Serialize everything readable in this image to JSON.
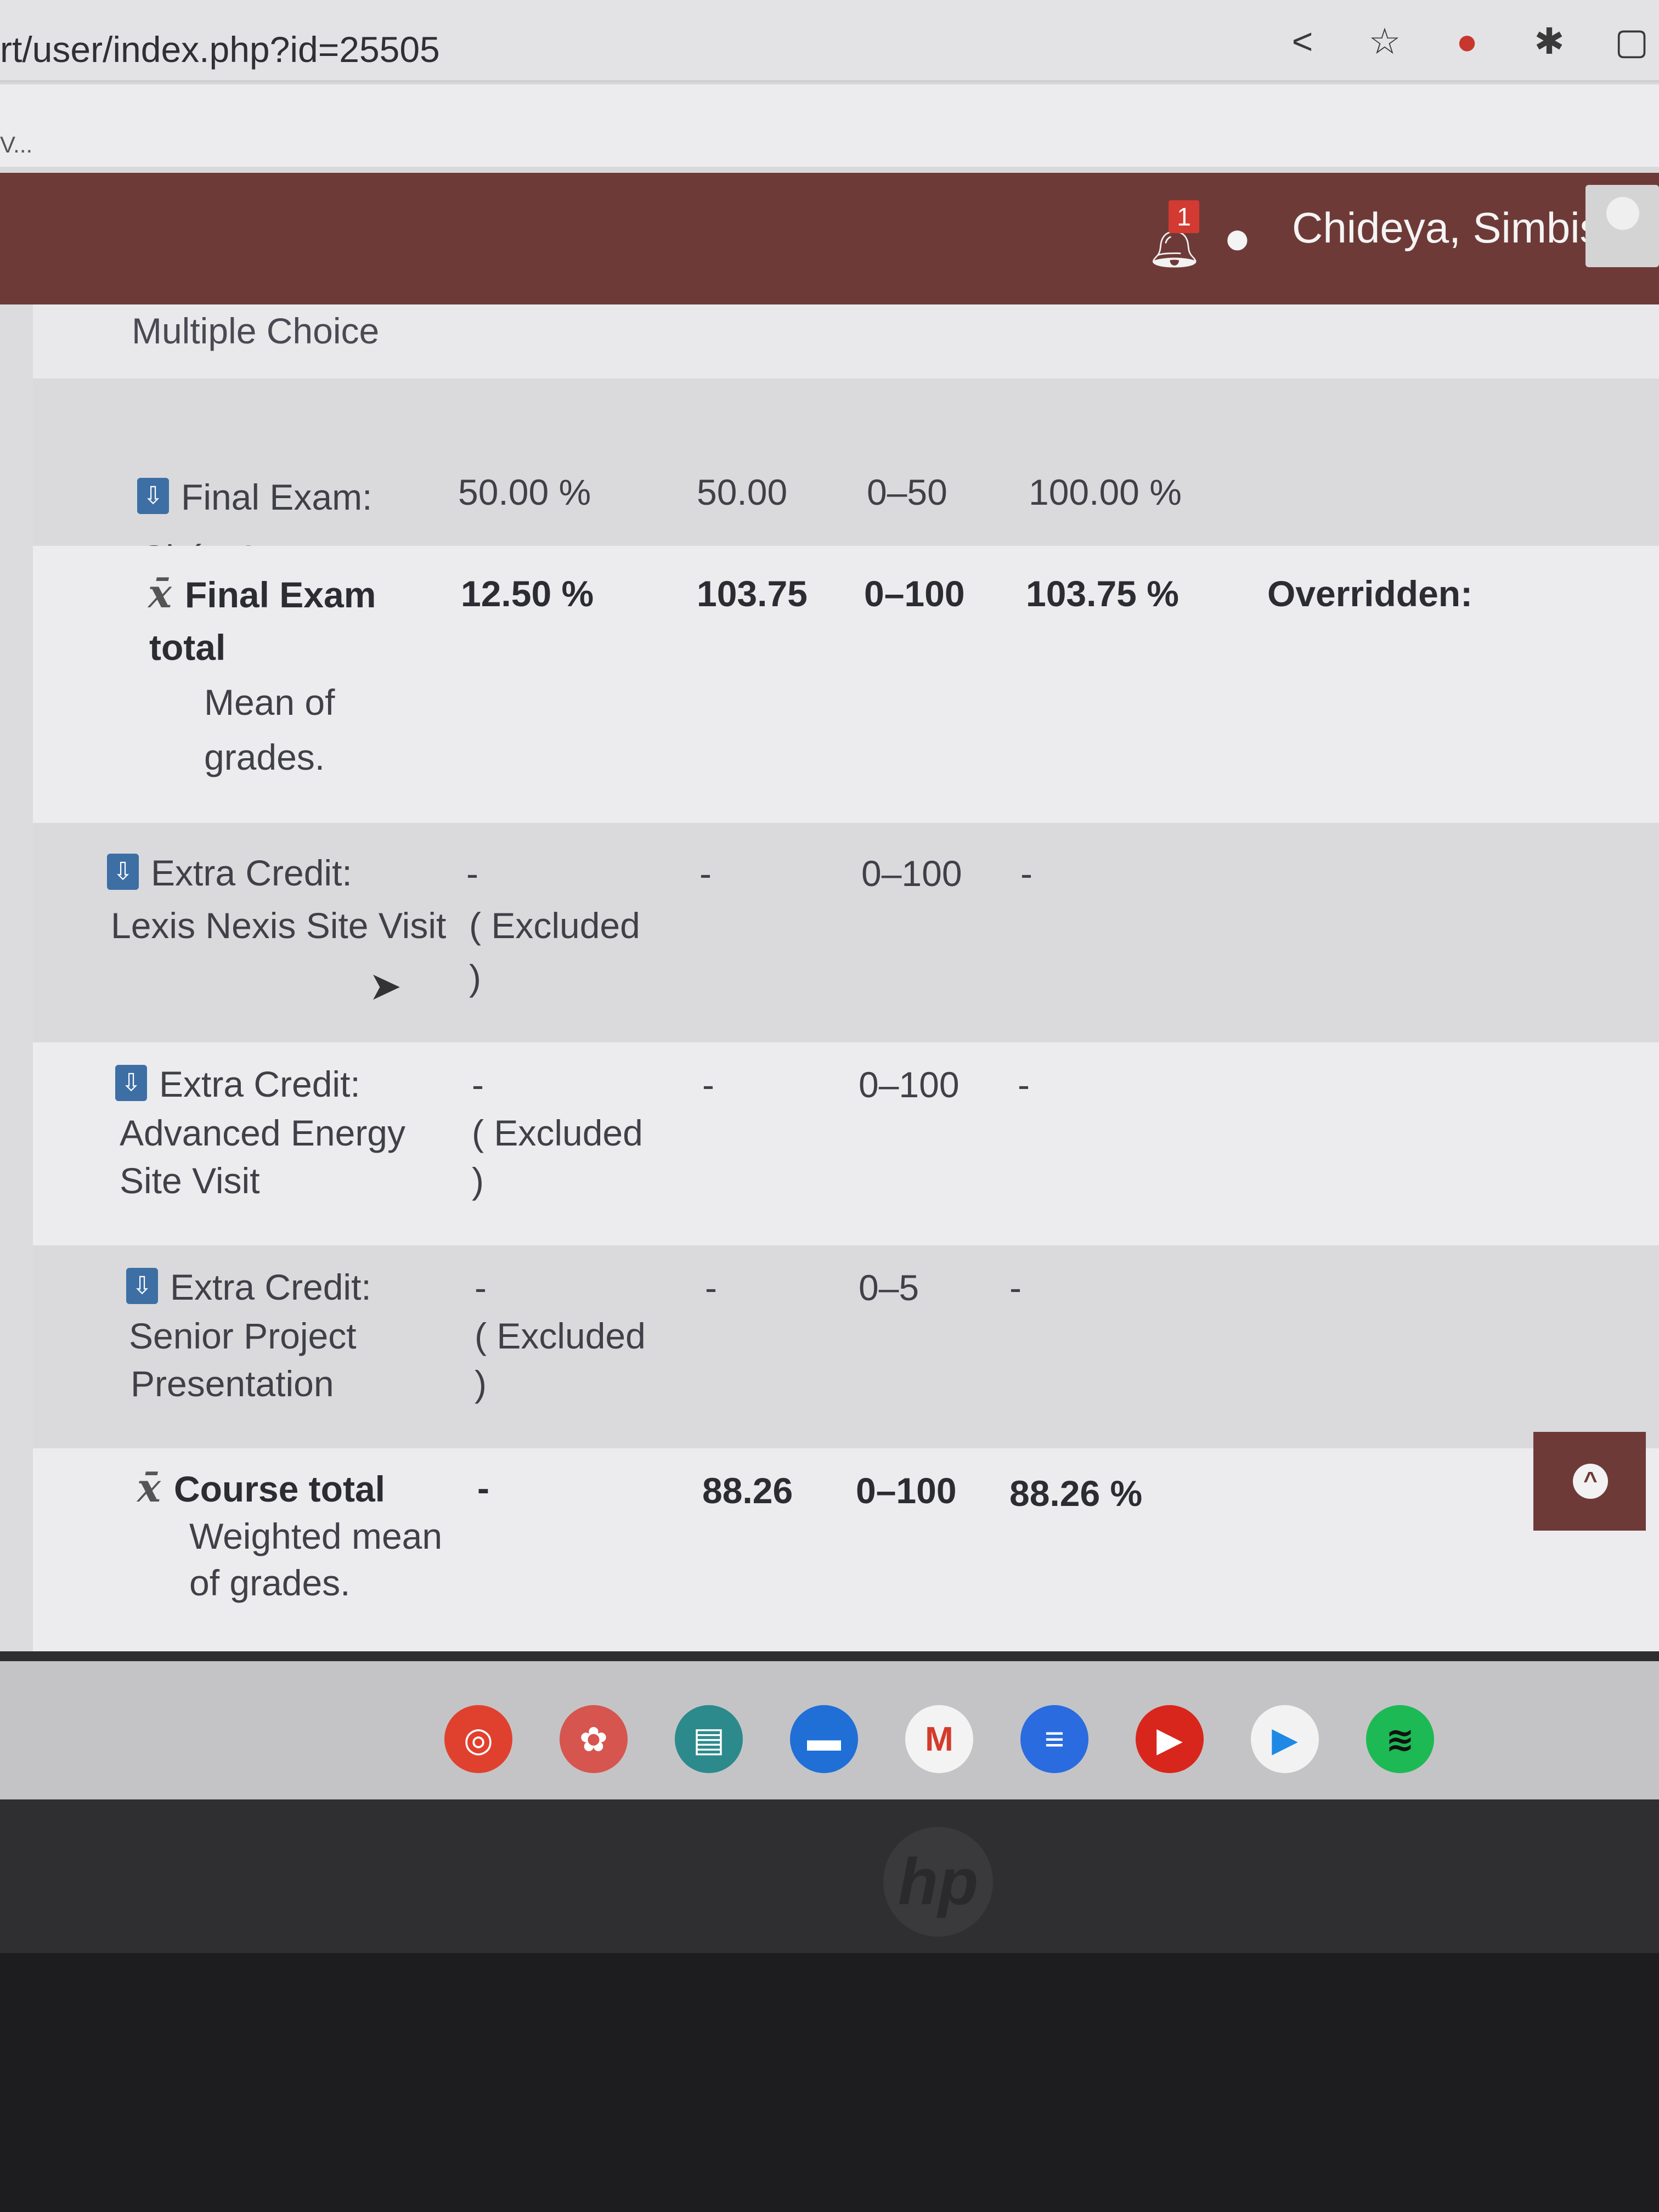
{
  "browser": {
    "url": "rt/user/index.php?id=25505",
    "bookmark_text": "V...",
    "icons": [
      "share-icon",
      "star-icon",
      "opera-icon",
      "puzzle-icon",
      "window-icon"
    ]
  },
  "header": {
    "notification_count": "1",
    "username": "Chideya, Simbiso"
  },
  "section_label": "Multiple Choice",
  "rows": {
    "final_short": {
      "name_line1": "Final Exam:",
      "name_line2": "Shórt Answer",
      "weight": "50.00 %",
      "grade": "50.00",
      "range": "0–50",
      "percentage": "100.00 %"
    },
    "final_total": {
      "name_line1": "Final Exam",
      "name_line2": "total",
      "sub_line1": "Mean of",
      "sub_line2": "grades.",
      "weight": "12.50 %",
      "grade": "103.75",
      "range": "0–100",
      "percentage": "103.75 %",
      "feedback": "Overridden:"
    },
    "lexis": {
      "name_line1": "Extra Credit:",
      "name_line2": "Lexis Nexis Site Visit",
      "weight": "-",
      "excluded_line1": "( Excluded",
      "excluded_line2": ")",
      "grade": "-",
      "range": "0–100",
      "percentage": "-"
    },
    "advanced": {
      "name_line1": "Extra Credit:",
      "name_line2": "Advanced Energy",
      "name_line3": "Site Visit",
      "weight": "-",
      "excluded_line1": "( Excluded",
      "excluded_line2": ")",
      "grade": "-",
      "range": "0–100",
      "percentage": "-"
    },
    "senior": {
      "name_line1": "Extra Credit:",
      "name_line2": "Senior Project",
      "name_line3": "Presentation",
      "weight": "-",
      "excluded_line1": "( Excluded",
      "excluded_line2": ")",
      "grade": "-",
      "range": "0–5",
      "percentage": "-"
    },
    "course_total": {
      "name_line1": "Course total",
      "sub_line1": "Weighted mean",
      "sub_line2": "of grades.",
      "weight": "-",
      "grade": "88.26",
      "range": "0–100",
      "percentage": "88.26 %"
    }
  },
  "shelf": {
    "apps": [
      "Chrome",
      "Canvas",
      "Classroom",
      "Files",
      "Gmail",
      "Docs",
      "YouTube",
      "Play Store",
      "Spotify"
    ],
    "brand": "hp"
  }
}
